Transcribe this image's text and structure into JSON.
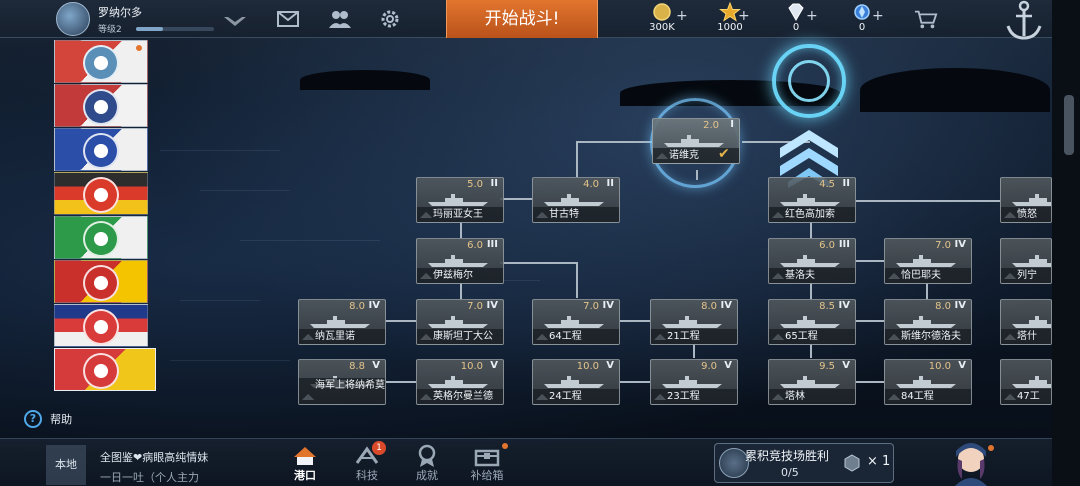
{
  "player": {
    "name": "罗纳尔多",
    "level": "等级2",
    "xp_fraction": 0.35
  },
  "top": {
    "battle_label": "开始战斗!",
    "icons": [
      "mail-icon",
      "friends-icon",
      "settings-icon",
      "shop-cart-icon",
      "anchor-icon"
    ],
    "currencies": [
      {
        "name": "silver-coin-icon",
        "value": "300K"
      },
      {
        "name": "star-icon",
        "value": "1000"
      },
      {
        "name": "diamond-icon",
        "value": "0"
      },
      {
        "name": "blue-crystal-icon",
        "value": "0"
      }
    ],
    "plus": "+"
  },
  "nations": [
    {
      "id": "nation-1",
      "colors": [
        "#d3443a",
        "#f0f0f0"
      ],
      "emblem": "#5a8fb8"
    },
    {
      "id": "nation-2",
      "colors": [
        "#c23a3a",
        "#f2f2f2"
      ],
      "emblem": "#2f4b8c"
    },
    {
      "id": "nation-3",
      "colors": [
        "#2b4ea8",
        "#f0f0f0"
      ],
      "emblem": "#2b4ea8"
    },
    {
      "id": "nation-4",
      "colors": [
        "#2d2d2d",
        "#d93a2a",
        "#f2c21a"
      ],
      "emblem": "#d93a2a"
    },
    {
      "id": "nation-5",
      "colors": [
        "#2c9a48",
        "#f0f0f0"
      ],
      "emblem": "#2c9a48"
    },
    {
      "id": "nation-6",
      "colors": [
        "#c9302c",
        "#f5c400"
      ],
      "emblem": "#c9302c"
    },
    {
      "id": "nation-7",
      "colors": [
        "#1f3a8a",
        "#d93a3a",
        "#f0f0f0"
      ],
      "emblem": "#d93a3a"
    },
    {
      "id": "nation-8",
      "colors": [
        "#d63b3b",
        "#f0c61a"
      ],
      "emblem": "#d63b3b",
      "active": true
    }
  ],
  "help_label": "帮助",
  "ships": [
    {
      "key": "nuoweike",
      "name": "诺维克",
      "br": "2.0",
      "tier": "I",
      "owned": true
    },
    {
      "key": "malia",
      "name": "玛丽亚女王",
      "br": "5.0",
      "tier": "II"
    },
    {
      "key": "gangute",
      "name": "甘古特",
      "br": "4.0",
      "tier": "II"
    },
    {
      "key": "hongse",
      "name": "红色高加索",
      "br": "4.5",
      "tier": "II"
    },
    {
      "key": "fennu",
      "name": "愤怒",
      "br": "",
      "tier": ""
    },
    {
      "key": "yizimaer",
      "name": "伊兹梅尔",
      "br": "6.0",
      "tier": "III"
    },
    {
      "key": "jiluofu",
      "name": "基洛夫",
      "br": "6.0",
      "tier": "III"
    },
    {
      "key": "qiabayefu",
      "name": "恰巴耶夫",
      "br": "7.0",
      "tier": "IV"
    },
    {
      "key": "lieningrad",
      "name": "列宁",
      "br": "",
      "tier": ""
    },
    {
      "key": "nawali",
      "name": "纳瓦里诺",
      "br": "8.0",
      "tier": "IV"
    },
    {
      "key": "kangsitanding",
      "name": "康斯坦丁大公",
      "br": "7.0",
      "tier": "IV"
    },
    {
      "key": "64gc",
      "name": "64工程",
      "br": "7.0",
      "tier": "IV"
    },
    {
      "key": "21gc",
      "name": "21工程",
      "br": "8.0",
      "tier": "IV"
    },
    {
      "key": "65gc",
      "name": "65工程",
      "br": "8.5",
      "tier": "IV"
    },
    {
      "key": "siweier",
      "name": "斯维尔德洛夫",
      "br": "8.0",
      "tier": "IV"
    },
    {
      "key": "taqi",
      "name": "塔什",
      "br": "",
      "tier": ""
    },
    {
      "key": "haijun",
      "name": "海军上将纳希莫夫",
      "br": "8.8",
      "tier": "V"
    },
    {
      "key": "yinggeer",
      "name": "英格尔曼兰德",
      "br": "10.0",
      "tier": "V"
    },
    {
      "key": "24gc",
      "name": "24工程",
      "br": "10.0",
      "tier": "V"
    },
    {
      "key": "23gc",
      "name": "23工程",
      "br": "9.0",
      "tier": "V"
    },
    {
      "key": "talin",
      "name": "塔林",
      "br": "9.5",
      "tier": "V"
    },
    {
      "key": "84gc",
      "name": "84工程",
      "br": "10.0",
      "tier": "V"
    },
    {
      "key": "47gc",
      "name": "47工",
      "br": "",
      "tier": ""
    }
  ],
  "bottom": {
    "local_tab": "本地",
    "chat_line1": "全图鉴❤病眼高纯情妹",
    "chat_line2": "一日一吐（个人主力",
    "nav": [
      {
        "label": "港口",
        "icon": "harbor-icon",
        "active": true
      },
      {
        "label": "科技",
        "icon": "tech-icon",
        "badge": "1"
      },
      {
        "label": "成就",
        "icon": "achievement-icon"
      },
      {
        "label": "补给箱",
        "icon": "supply-box-icon",
        "dot": true
      }
    ],
    "arena_title": "累积竞技场胜利",
    "arena_progress": "0/5",
    "arena_multiplier": "× 1"
  }
}
